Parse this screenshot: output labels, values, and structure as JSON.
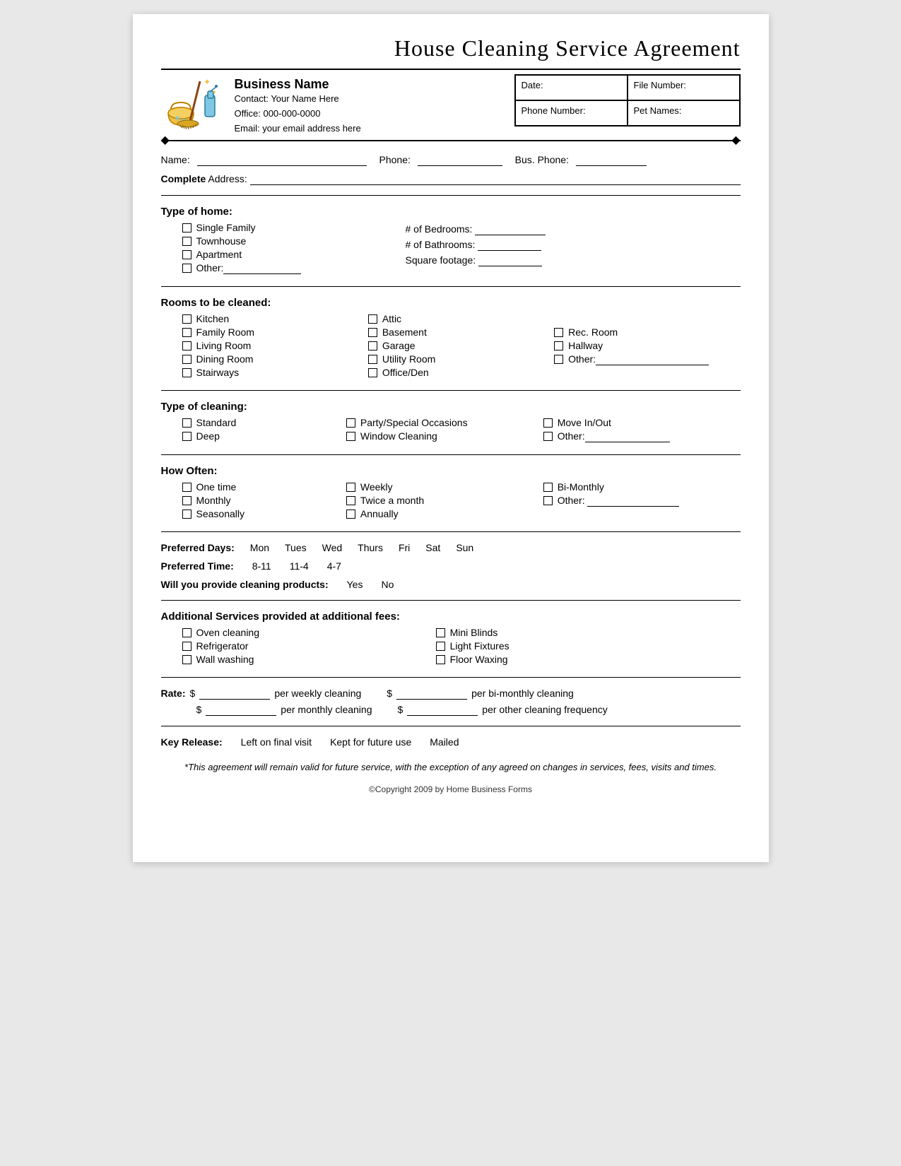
{
  "title": "House Cleaning Service Agreement",
  "header": {
    "business_name": "Business Name",
    "contact_label": "Contact:",
    "contact_value": "Your Name Here",
    "office_label": "Office:",
    "office_value": "000-000-0000",
    "email_label": "Email:",
    "email_value": "your email address here",
    "fields": [
      {
        "label": "Date:",
        "value": ""
      },
      {
        "label": "File Number:",
        "value": ""
      },
      {
        "label": "Phone Number:",
        "value": ""
      },
      {
        "label": "Pet Names:",
        "value": ""
      }
    ]
  },
  "form": {
    "name_label": "Name:",
    "phone_label": "Phone:",
    "bus_phone_label": "Bus. Phone:",
    "complete_address_label": "Complete Address:",
    "type_of_home": {
      "title": "Type of home:",
      "options": [
        "Single Family",
        "Townhouse",
        "Apartment",
        "Other:________________"
      ],
      "fields": [
        {
          "label": "# of Bedrooms:",
          "blank": "____________"
        },
        {
          "label": "# of Bathrooms:",
          "blank": "___________"
        },
        {
          "label": "Square footage:",
          "blank": "___________"
        }
      ]
    },
    "rooms_to_be_cleaned": {
      "title": "Rooms to be cleaned:",
      "col1": [
        "Kitchen",
        "Family Room",
        "Living Room",
        "Dining Room",
        "Stairways"
      ],
      "col2": [
        "Attic",
        "Basement",
        "Garage",
        "Utility Room",
        "Office/Den"
      ],
      "col3": [
        "",
        "Rec. Room",
        "Hallway",
        "Other:_________________________",
        ""
      ]
    },
    "type_of_cleaning": {
      "title": "Type of cleaning:",
      "col1": [
        "Standard",
        "Deep"
      ],
      "col2": [
        "Party/Special Occasions",
        "Window Cleaning"
      ],
      "col3": [
        "Move In/Out",
        "Other:________________"
      ]
    },
    "how_often": {
      "title": "How Often:",
      "col1": [
        "One time",
        "Monthly",
        "Seasonally"
      ],
      "col2": [
        "Weekly",
        "Twice a month",
        "Annually"
      ],
      "col3": [
        "Bi-Monthly",
        "Other: ____________________"
      ]
    },
    "preferred_days": {
      "label": "Preferred Days:",
      "days": [
        "Mon",
        "Tues",
        "Wed",
        "Thurs",
        "Fri",
        "Sat",
        "Sun"
      ]
    },
    "preferred_time": {
      "label": "Preferred Time:",
      "times": [
        "8-11",
        "11-4",
        "4-7"
      ]
    },
    "cleaning_products": {
      "label": "Will you provide cleaning products:",
      "options": [
        "Yes",
        "No"
      ]
    },
    "additional_services": {
      "title": "Additional Services provided at additional fees:",
      "col1": [
        "Oven cleaning",
        "Refrigerator",
        "Wall washing"
      ],
      "col2": [
        "Mini Blinds",
        "Light Fixtures",
        "Floor Waxing"
      ]
    },
    "rate": {
      "label": "Rate:",
      "currency": "$",
      "line1": [
        {
          "blank": "___________",
          "text": "per weekly cleaning"
        },
        {
          "blank": "___________",
          "text": "per bi-monthly cleaning"
        }
      ],
      "line2": [
        {
          "blank": "___________",
          "text": "per monthly cleaning"
        },
        {
          "blank": "___________",
          "text": "per other cleaning frequency"
        }
      ]
    },
    "key_release": {
      "label": "Key Release:",
      "options": [
        "Left on final visit",
        "Kept for future use",
        "Mailed"
      ]
    },
    "footer_note": "*This agreement will remain valid for future service, with the exception of any agreed on changes in services, fees, visits and times.",
    "copyright": "©Copyright 2009 by Home Business Forms"
  }
}
